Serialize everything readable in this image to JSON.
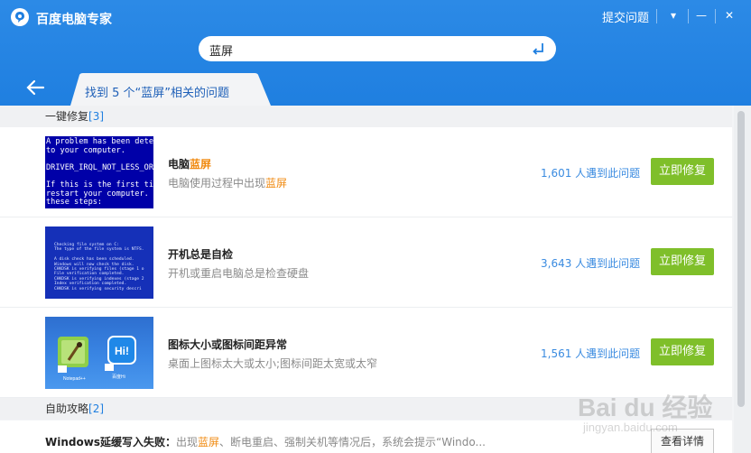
{
  "app": {
    "title": "百度电脑专家",
    "feedback_label": "提交问题",
    "dropdown_icon": "▾",
    "minimize_icon": "—",
    "close_icon": "✕"
  },
  "search": {
    "value": "蓝屏"
  },
  "tab": {
    "prefix": "找到 5 个“",
    "keyword": "蓝屏",
    "suffix": "”相关的问题"
  },
  "sections": {
    "quick_fix": {
      "label": "一键修复",
      "count": "[3]"
    },
    "self_help": {
      "label": "自助攻略",
      "count": "[2]"
    }
  },
  "items": [
    {
      "title_prefix": "电脑",
      "title_highlight": "蓝屏",
      "desc_prefix": "电脑使用过程中出现",
      "desc_highlight": "蓝屏",
      "stat": "1,601 人遇到此问题",
      "button": "立即修复",
      "thumb_text": "A problem has been dete\nto your computer.\n\nDRIVER_IRQL_NOT_LESS_OR\n\nIf this is the first ti\nrestart your computer.\nthese steps:"
    },
    {
      "title_prefix": "开机总是自检",
      "title_highlight": "",
      "desc_prefix": "开机或重启电脑总是检查硬盘",
      "desc_highlight": "",
      "stat": "3,643 人遇到此问题",
      "button": "立即修复",
      "thumb_text": "Checking file system on C:\nThe type of the file system is NTFS.\n\nA disk check has been scheduled.\nWindows will now check the disk.\nCHKDSK is verifying files (stage 1 o\nFile verification completed.\nCHKDSK is verifying indexes (stage 2\nIndex verification completed.\nCHKDSK is verifying security descri"
    },
    {
      "title_prefix": "图标大小或图标间距异常",
      "title_highlight": "",
      "desc_prefix": "桌面上图标太大或太小;图标间距太宽或太窄",
      "desc_highlight": "",
      "stat": "1,561 人遇到此问题",
      "button": "立即修复",
      "thumb_icon_labels": [
        "Notepad++",
        "百度Hi"
      ]
    }
  ],
  "guide": {
    "title": "Windows延缓写入失败：",
    "text_before": "出现",
    "highlight": "蓝屏",
    "text_after": "、断电重启、强制关机等情况后，系统会提示“Windo...",
    "button": "查看详情"
  },
  "watermark": {
    "logo": "Bai du 经验",
    "url": "jingyan.baidu.com"
  }
}
